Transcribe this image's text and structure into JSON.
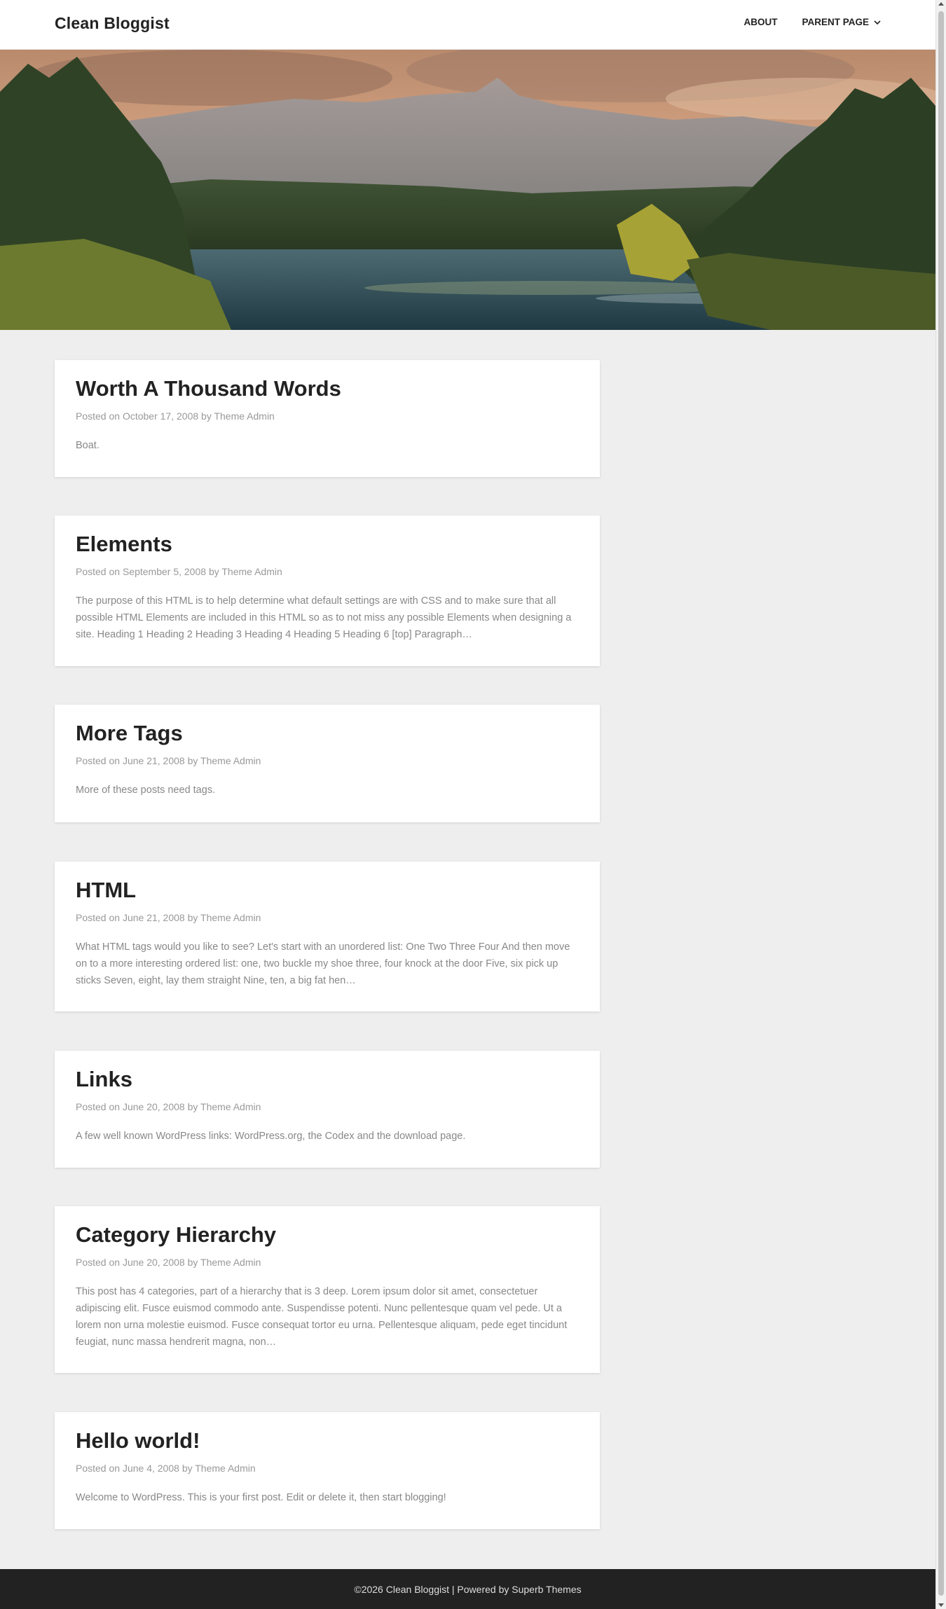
{
  "site": {
    "title": "Clean Bloggist"
  },
  "nav": {
    "items": [
      {
        "label": "ABOUT"
      },
      {
        "label": "PARENT PAGE",
        "icon": "chevron-down-icon"
      }
    ]
  },
  "hero": {
    "image": "mountain-lake-landscape"
  },
  "posts": [
    {
      "title": "Worth A Thousand Words",
      "posted_on": "Posted on",
      "date": "October 17, 2008",
      "by": "by",
      "author": "Theme Admin",
      "excerpt": "Boat."
    },
    {
      "title": "Elements",
      "posted_on": "Posted on",
      "date": "September 5, 2008",
      "by": "by",
      "author": "Theme Admin",
      "excerpt": "The purpose of this HTML is to help determine what default settings are with CSS and to make sure that all possible HTML Elements are included in this HTML so as to not miss any possible Elements when designing a site. Heading 1 Heading 2 Heading 3 Heading 4 Heading 5 Heading 6 [top] Paragraph…"
    },
    {
      "title": "More Tags",
      "posted_on": "Posted on",
      "date": "June 21, 2008",
      "by": "by",
      "author": "Theme Admin",
      "excerpt": "More of these posts need tags."
    },
    {
      "title": "HTML",
      "posted_on": "Posted on",
      "date": "June 21, 2008",
      "by": "by",
      "author": "Theme Admin",
      "excerpt": "What HTML tags would you like to see? Let's start with an unordered list: One Two Three Four And then move on to a more interesting ordered list: one, two buckle my shoe three, four knock at the door Five, six pick up sticks Seven, eight, lay them straight Nine, ten, a big fat hen…"
    },
    {
      "title": "Links",
      "posted_on": "Posted on",
      "date": "June 20, 2008",
      "by": "by",
      "author": "Theme Admin",
      "excerpt": "A few well known WordPress links: WordPress.org, the Codex and the download page."
    },
    {
      "title": "Category Hierarchy",
      "posted_on": "Posted on",
      "date": "June 20, 2008",
      "by": "by",
      "author": "Theme Admin",
      "excerpt": "This post has 4 categories, part of a hierarchy that is 3 deep. Lorem ipsum dolor sit amet, consectetuer adipiscing elit. Fusce euismod commodo ante. Suspendisse potenti. Nunc pellentesque quam vel pede. Ut a lorem non urna molestie euismod. Fusce consequat tortor eu urna. Pellentesque aliquam, pede eget tincidunt feugiat, nunc massa hendrerit magna, non…"
    },
    {
      "title": "Hello world!",
      "posted_on": "Posted on",
      "date": "June 4, 2008",
      "by": "by",
      "author": "Theme Admin",
      "excerpt": "Welcome to WordPress. This is your first post. Edit or delete it, then start blogging!"
    }
  ],
  "footer": {
    "copyright": "©2026 Clean Bloggist",
    "separator": " | ",
    "powered_by": "Powered by",
    "theme_link": "Superb Themes"
  },
  "colors": {
    "background": "#eeeeee",
    "card": "#ffffff",
    "title_text": "#222222",
    "meta_text": "#999999",
    "body_text": "#888888",
    "footer_bg": "#222222"
  }
}
